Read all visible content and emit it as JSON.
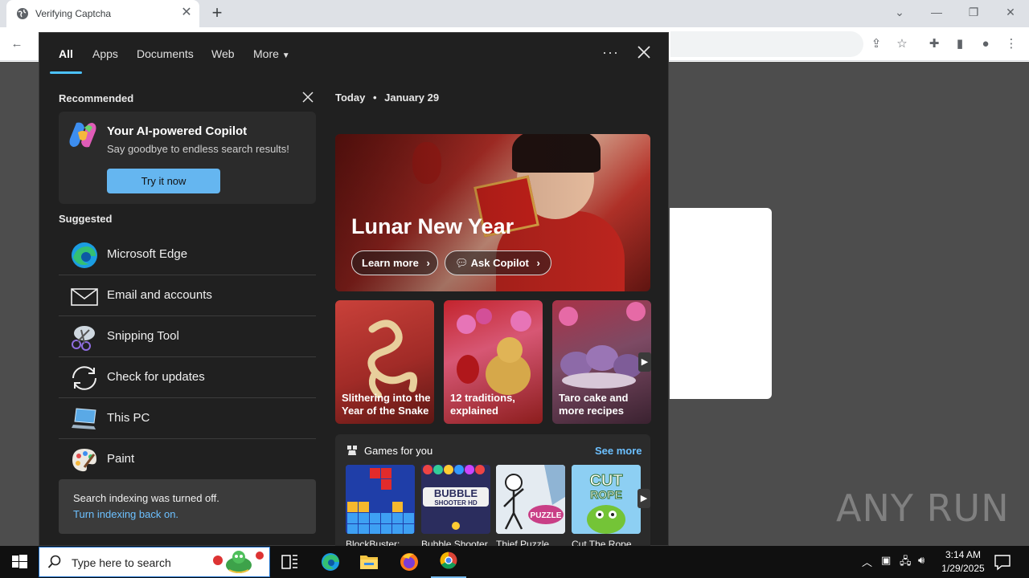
{
  "browser": {
    "tab_title": "Verifying Captcha",
    "tab_close": "✕",
    "new_tab": "+"
  },
  "watermark": "ANY RUN",
  "search_panel": {
    "tabs": [
      "All",
      "Apps",
      "Documents",
      "Web",
      "More"
    ],
    "more_dots": "···",
    "recommended_heading": "Recommended",
    "copilot": {
      "title": "Your AI-powered Copilot",
      "subtitle": "Say goodbye to endless search results!",
      "button": "Try it now"
    },
    "suggested_heading": "Suggested",
    "suggested": [
      {
        "label": "Microsoft Edge",
        "icon": "edge-icon"
      },
      {
        "label": "Email and accounts",
        "icon": "mail-icon"
      },
      {
        "label": "Snipping Tool",
        "icon": "snipping-tool-icon"
      },
      {
        "label": "Check for updates",
        "icon": "refresh-icon"
      },
      {
        "label": "This PC",
        "icon": "this-pc-icon"
      },
      {
        "label": "Paint",
        "icon": "paint-palette-icon"
      }
    ],
    "notice": {
      "text": "Search indexing was turned off.",
      "link": "Turn indexing back on."
    },
    "today": {
      "label": "Today",
      "separator": "•",
      "date": "January 29"
    },
    "hero": {
      "title": "Lunar New Year",
      "learn_more": "Learn more",
      "ask_copilot": "Ask Copilot"
    },
    "tiles": [
      {
        "caption_line1": "Slithering into the",
        "caption_line2": "Year of the Snake"
      },
      {
        "caption_line1": "12 traditions,",
        "caption_line2": "explained"
      },
      {
        "caption_line1": "Taro cake and",
        "caption_line2": "more recipes"
      }
    ],
    "games": {
      "title": "Games for you",
      "see_more": "See more",
      "items": [
        "BlockBuster:",
        "Bubble Shooter",
        "Thief Puzzle",
        "Cut The Rope"
      ]
    }
  },
  "taskbar": {
    "search_placeholder": "Type here to search",
    "time": "3:14 AM",
    "date": "1/29/2025"
  },
  "colors": {
    "panel_bg": "#202020",
    "accent": "#4cc2ff",
    "link": "#6cc0ff",
    "copilot_button": "#65b6f0",
    "taskbar_bg": "#101010"
  }
}
